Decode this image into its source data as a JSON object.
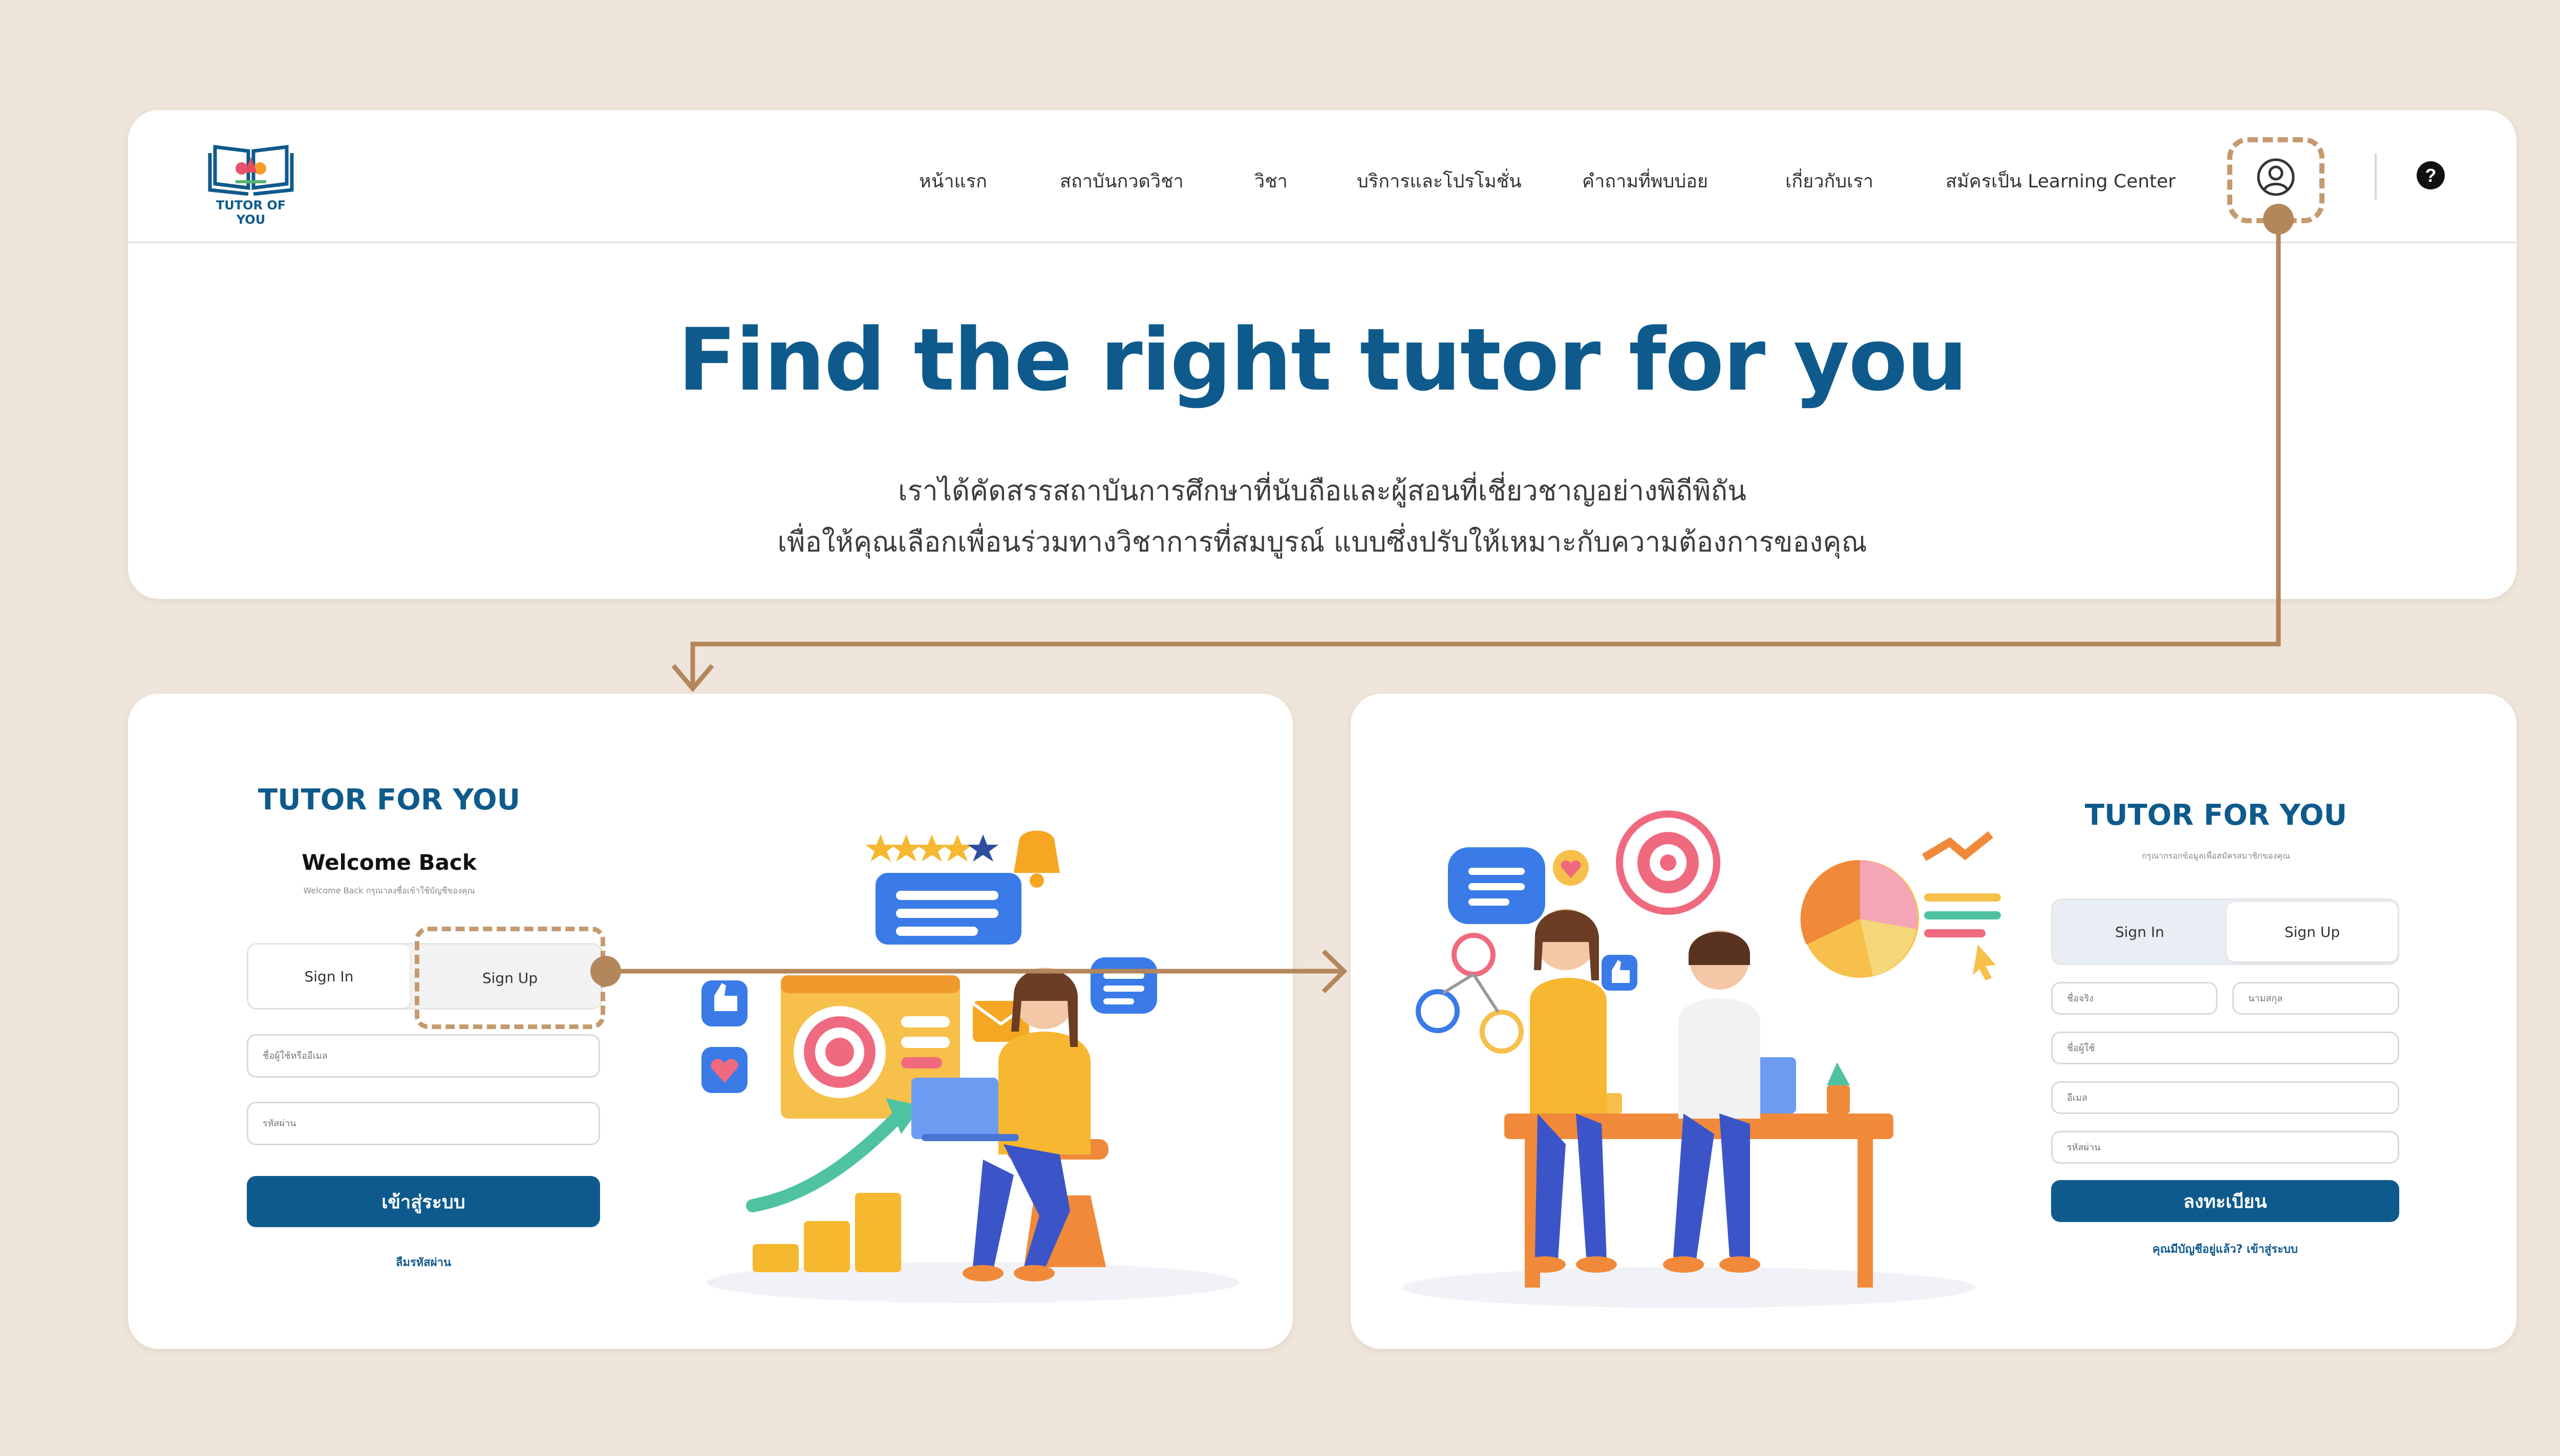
{
  "brand": {
    "logo_text": "TUTOR OF YOU"
  },
  "nav": {
    "items": [
      {
        "label": "หน้าแรก"
      },
      {
        "label": "สถาบันกวดวิชา"
      },
      {
        "label": "วิชา"
      },
      {
        "label": "บริการและโปรโมชั่น"
      },
      {
        "label": "คำถามที่พบบ่อย"
      },
      {
        "label": "เกี่ยวกับเรา"
      },
      {
        "label": "สมัครเป็น Learning Center"
      }
    ],
    "help_symbol": "?"
  },
  "hero": {
    "title": "Find the right tutor for you",
    "subtitle_line1": "เราได้คัดสรรสถาบันการศึกษาที่นับถือและผู้สอนที่เชี่ยวชาญอย่างพิถีพิถัน",
    "subtitle_line2": "เพื่อให้คุณเลือกเพื่อนร่วมทางวิชาการที่สมบูรณ์  แบบซึ่งปรับให้เหมาะกับความต้องการของคุณ"
  },
  "signin": {
    "brand": "TUTOR FOR YOU",
    "welcome": "Welcome Back",
    "tagline": "Welcome Back กรุณาลงชื่อเข้าใช้บัญชีของคุณ",
    "tab_signin": "Sign In",
    "tab_signup": "Sign Up",
    "username_placeholder": "ชื่อผู้ใช้หรืออีเมล",
    "password_placeholder": "รหัสผ่าน",
    "submit_label": "เข้าสู่ระบบ",
    "forgot_label": "ลืมรหัสผ่าน"
  },
  "signup": {
    "brand": "TUTOR FOR YOU",
    "tagline": "กรุณากรอกข้อมูลเพื่อสมัครสมาชิกของคุณ",
    "tab_signin": "Sign In",
    "tab_signup": "Sign Up",
    "firstname_placeholder": "ชื่อจริง",
    "lastname_placeholder": "นามสกุล",
    "username_placeholder": "ชื่อผู้ใช้",
    "email_placeholder": "อีเมล",
    "password_placeholder": "รหัสผ่าน",
    "submit_label": "ลงทะเบียน",
    "login_link": "คุณมีบัญชีอยู่แล้ว? เข้าสู่ระบบ"
  },
  "colors": {
    "background": "#efe5da",
    "brand_blue": "#0f5a8c",
    "accent_tan": "#c59a6e",
    "card": "#ffffff"
  },
  "icons": [
    "book-logo-icon",
    "user-icon",
    "help-icon",
    "arrow-flow-connector"
  ]
}
